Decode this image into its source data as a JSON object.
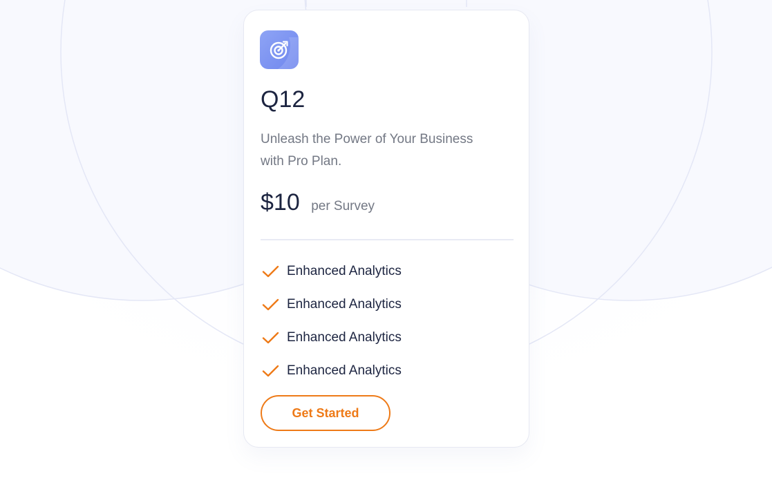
{
  "plan": {
    "icon": "target-icon",
    "name": "Q12",
    "description": "Unleash the Power of Your Business with Pro Plan.",
    "price": "$10",
    "price_unit": "per Survey",
    "features": [
      "Enhanced Analytics",
      "Enhanced Analytics",
      "Enhanced Analytics",
      "Enhanced Analytics"
    ],
    "cta_label": "Get Started"
  },
  "colors": {
    "accent": "#ee7a17",
    "icon_gradient_start": "#8ea4f5",
    "icon_gradient_end": "#6f86ee",
    "heading": "#1c2440",
    "muted_text": "#737884",
    "background_circles": "#e4e7f6"
  }
}
